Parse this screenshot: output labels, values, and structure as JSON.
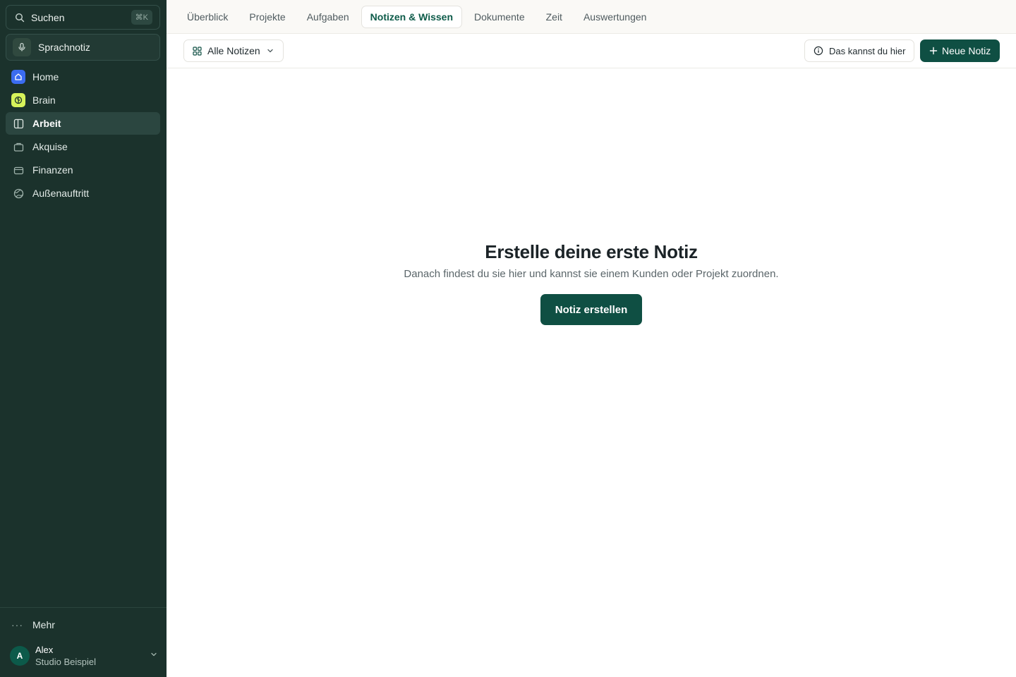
{
  "sidebar": {
    "search": {
      "label": "Suchen",
      "shortcut": "⌘K",
      "icon": "search-icon"
    },
    "voice_note": {
      "label": "Sprachnotiz",
      "icon": "microphone-icon"
    },
    "items": [
      {
        "label": "Home",
        "icon": "home-icon",
        "icon_bg": "#3b6cf0",
        "active": false
      },
      {
        "label": "Brain",
        "icon": "brain-icon",
        "icon_bg": "#d7f35a",
        "active": false
      },
      {
        "label": "Arbeit",
        "icon": "columns-icon",
        "active": true
      },
      {
        "label": "Akquise",
        "icon": "briefcase-icon",
        "active": false
      },
      {
        "label": "Finanzen",
        "icon": "wallet-icon",
        "active": false
      },
      {
        "label": "Außenauftritt",
        "icon": "globe-icon",
        "active": false
      }
    ],
    "more_label": "Mehr",
    "user": {
      "initial": "A",
      "name": "Alex",
      "org": "Studio Beispiel"
    }
  },
  "tabs": [
    {
      "label": "Überblick",
      "active": false
    },
    {
      "label": "Projekte",
      "active": false
    },
    {
      "label": "Aufgaben",
      "active": false
    },
    {
      "label": "Notizen & Wissen",
      "active": true
    },
    {
      "label": "Dokumente",
      "active": false
    },
    {
      "label": "Zeit",
      "active": false
    },
    {
      "label": "Auswertungen",
      "active": false
    }
  ],
  "toolbar": {
    "filter_label": "Alle Notizen",
    "help_label": "Das kannst du hier",
    "new_note_label": "Neue Notiz"
  },
  "empty_state": {
    "title": "Erstelle deine erste Notiz",
    "subtitle": "Danach findest du sie hier und kannst sie einem Kunden oder Projekt zuordnen.",
    "button_label": "Notiz erstellen"
  },
  "colors": {
    "sidebar_bg": "#1b322c",
    "accent": "#0f4f43",
    "active_tab_text": "#0d5b49"
  }
}
